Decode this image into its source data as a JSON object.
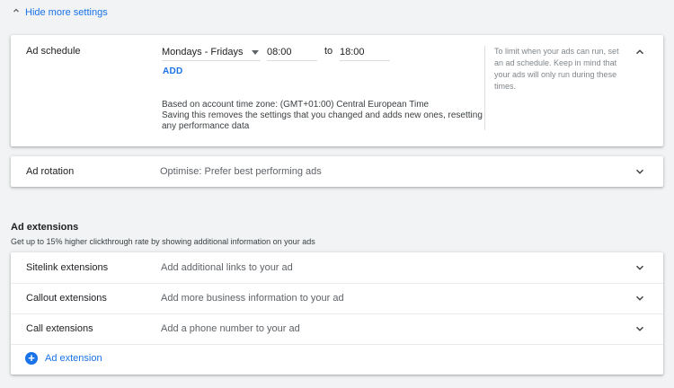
{
  "settings_toggle": {
    "label": "Hide more settings",
    "icon": "chevron-up-icon"
  },
  "ad_schedule": {
    "label": "Ad schedule",
    "day_select": "Mondays - Fridays",
    "start_time": "08:00",
    "to_label": "to",
    "end_time": "18:00",
    "add_label": "ADD",
    "timezone_note": "Based on account time zone: (GMT+01:00) Central European Time",
    "reset_note": "Saving this removes the settings that you changed and adds new ones, resetting any performance data",
    "help_text": "To limit when your ads can run, set an ad schedule. Keep in mind that your ads will only run during these times."
  },
  "ad_rotation": {
    "label": "Ad rotation",
    "value": "Optimise: Prefer best performing ads"
  },
  "ad_extensions": {
    "heading": "Ad extensions",
    "subtitle": "Get up to 15% higher clickthrough rate by showing additional information on your ads",
    "rows": [
      {
        "label": "Sitelink extensions",
        "value": "Add additional links to your ad"
      },
      {
        "label": "Callout extensions",
        "value": "Add more business information to your ad"
      },
      {
        "label": "Call extensions",
        "value": "Add a phone number to your ad"
      }
    ],
    "add_label": "Ad extension"
  },
  "colors": {
    "accent": "#1a73e8",
    "background": "#f1f3f4",
    "card": "#ffffff"
  }
}
